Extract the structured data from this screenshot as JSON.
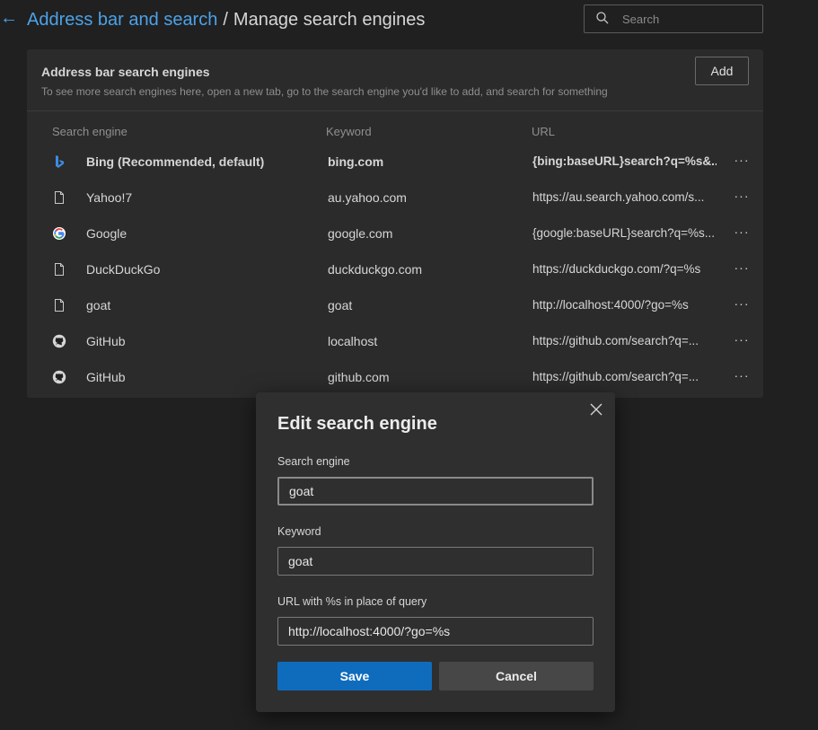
{
  "header": {
    "breadcrumb_parent": "Address bar and search",
    "breadcrumb_separator": "/",
    "breadcrumb_current": "Manage search engines",
    "search_placeholder": "Search"
  },
  "panel": {
    "title": "Address bar search engines",
    "description": "To see more search engines here, open a new tab, go to the search engine you'd like to add, and search for something",
    "add_label": "Add",
    "columns": {
      "name": "Search engine",
      "keyword": "Keyword",
      "url": "URL"
    },
    "rows": [
      {
        "name": "Bing (Recommended, default)",
        "keyword": "bing.com",
        "url": "{bing:baseURL}search?q=%s&...",
        "icon": "bing-icon"
      },
      {
        "name": "Yahoo!7",
        "keyword": "au.yahoo.com",
        "url": "https://au.search.yahoo.com/s...",
        "icon": "document-icon"
      },
      {
        "name": "Google",
        "keyword": "google.com",
        "url": "{google:baseURL}search?q=%s...",
        "icon": "google-icon"
      },
      {
        "name": "DuckDuckGo",
        "keyword": "duckduckgo.com",
        "url": "https://duckduckgo.com/?q=%s",
        "icon": "document-icon"
      },
      {
        "name": "goat",
        "keyword": "goat",
        "url": "http://localhost:4000/?go=%s",
        "icon": "document-icon"
      },
      {
        "name": "GitHub",
        "keyword": "localhost",
        "url": "https://github.com/search?q=...",
        "icon": "github-icon"
      },
      {
        "name": "GitHub",
        "keyword": "github.com",
        "url": "https://github.com/search?q=...",
        "icon": "github-icon"
      }
    ],
    "more_label": "···"
  },
  "dialog": {
    "title": "Edit search engine",
    "engine_label": "Search engine",
    "engine_value": "goat",
    "keyword_label": "Keyword",
    "keyword_value": "goat",
    "url_label": "URL with %s in place of query",
    "url_value": "http://localhost:4000/?go=%s",
    "save_label": "Save",
    "cancel_label": "Cancel"
  },
  "colors": {
    "background": "#202020",
    "panel": "#2b2b2b",
    "link": "#4ca2e8",
    "primary": "#0f6cbd",
    "dialog": "#2f2f2f"
  }
}
